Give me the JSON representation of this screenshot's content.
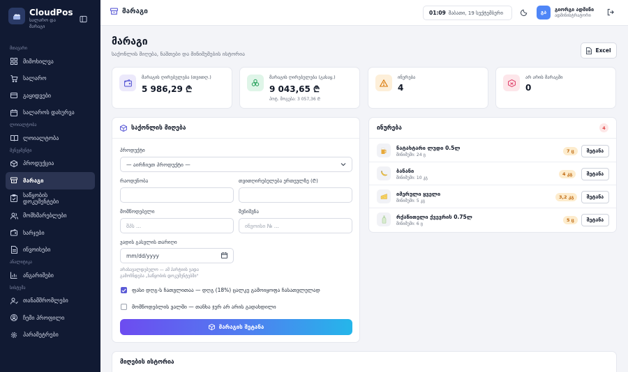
{
  "brand": {
    "name": "CloudPos",
    "subtitle_line1": "სალარო და",
    "subtitle_line2": "მარაგი"
  },
  "sidebar": {
    "sections": [
      {
        "label": "მთავარი"
      },
      {
        "label": "ლოიალტობა"
      },
      {
        "label": "მენეჯმენტი"
      },
      {
        "label": "ანალიტიკა"
      },
      {
        "label": "სისტემა"
      }
    ],
    "items": [
      {
        "label": "მიმოხილვა",
        "icon": "grid-icon"
      },
      {
        "label": "სალარო",
        "icon": "cart-icon"
      },
      {
        "label": "გაყიდვები",
        "icon": "receipt-icon"
      },
      {
        "label": "სალაროს დახურვა",
        "icon": "calendar-icon"
      },
      {
        "label": "ლოიალტობა",
        "icon": "book-icon"
      },
      {
        "label": "პროდუქცია",
        "icon": "box-icon"
      },
      {
        "label": "მარაგი",
        "icon": "stack-icon",
        "active": true
      },
      {
        "label_line1": "საწყობის",
        "label_line2": "დოკუმენტები",
        "icon": "clipboard-icon"
      },
      {
        "label": "მომხმარებლები",
        "icon": "users-icon"
      },
      {
        "label": "ხარჯები",
        "icon": "wallet-icon"
      },
      {
        "label": "ინვოისები",
        "icon": "document-icon"
      },
      {
        "label": "ანგარიშები",
        "icon": "chart-icon"
      },
      {
        "label": "თანამშრომლები",
        "icon": "staff-icon"
      },
      {
        "label": "ჩემი პროფილი",
        "icon": "profile-icon"
      },
      {
        "label": "პარამეტრები",
        "icon": "gear-icon"
      }
    ]
  },
  "topbar": {
    "title": "მარაგი",
    "time": "01:09",
    "date": "შაბათი, 19 სექტემბერი",
    "user_name": "გიორგი ადმინი",
    "user_role": "ადმინისტრატორი",
    "user_initials": "გა"
  },
  "page": {
    "title": "მარაგი",
    "subtitle": "საქონლის მიღება, ნაშთები და მინიმუმების ისტორია",
    "excel_label": "Excel"
  },
  "stats": [
    {
      "label": "მარაგის ღირებულება (თვითღ.)",
      "value": "5 986,29 ₾",
      "extra": "",
      "icon": "wallet-icon",
      "color": "#ece9fb"
    },
    {
      "label": "მარაგის ღირებულება (გასაყ.)",
      "value": "9 043,65 ₾",
      "extra": "პოტ. მოგება: 3 057,36 ₾",
      "icon": "coins-icon",
      "color": "#dff5e8"
    },
    {
      "label": "ინურება",
      "value": "4",
      "extra": "",
      "icon": "warning-icon",
      "color": "#fdefd9"
    },
    {
      "label": "არ არის მარაგში",
      "value": "0",
      "extra": "",
      "icon": "box-x-icon",
      "color": "#fde6ea"
    }
  ],
  "receive_form": {
    "title": "საქონლის მიღება",
    "product_label": "პროდუქტი",
    "product_value": "— აირჩიეთ პროდუქტი —",
    "quantity_label": "რაოდენობა",
    "unit_cost_label": "თვითღირებულება ერთეულზე (₾)",
    "supplier_label": "მომწოდებელი",
    "supplier_placeholder": "შპს ...",
    "note_label": "შენიშვნა",
    "note_placeholder": "ინვოისი № ...",
    "expiry_label": "ვადის გასვლის თარიღი",
    "expiry_placeholder": "mm/dd/yyyy",
    "hint_line1": "არასავალდებულო — ამ პარტიის ვადა",
    "hint_line2": "გამოჩნდება „საწყობის დოკუმენტებში\"",
    "vat_label": "ფასი დღგ-ს ჩათვლითაა — დღგ (18%) ცალკე გამოიყოფა ჩასათვლელად",
    "vat_checked": true,
    "debt_label": "მომწოდებლის ვალში — თანხა ჯერ არ არის გადახდილი",
    "debt_checked": false,
    "submit_label": "მარაგის შეტანა"
  },
  "low_stock": {
    "title": "ინურება",
    "count": "4",
    "reorder_label": "შეტანა",
    "items": [
      {
        "name": "ნატახტარი ლუდი 0.5ლ",
        "min": "მინიმუმი: 24 ც",
        "qty": "7 ც",
        "glyph": "🍺"
      },
      {
        "name": "ბანანი",
        "min": "მინიმუმი: 10 კგ",
        "qty": "4 კგ",
        "glyph": "🍌"
      },
      {
        "name": "იმერული ყველი",
        "min": "მინიმუმი: 5 კგ",
        "qty": "3,2 კგ",
        "glyph": "🧀"
      },
      {
        "name": "რქაწითელი ქვევრის 0.75ლ",
        "min": "მინიმუმი: 6 ც",
        "qty": "5 ც",
        "glyph": "🍾"
      }
    ]
  },
  "history": {
    "title": "მიღების ისტორია"
  },
  "colors": {
    "sidebar": "#111a33",
    "accent": "#5b5bd6",
    "warning_badge": "#fdeccd"
  }
}
